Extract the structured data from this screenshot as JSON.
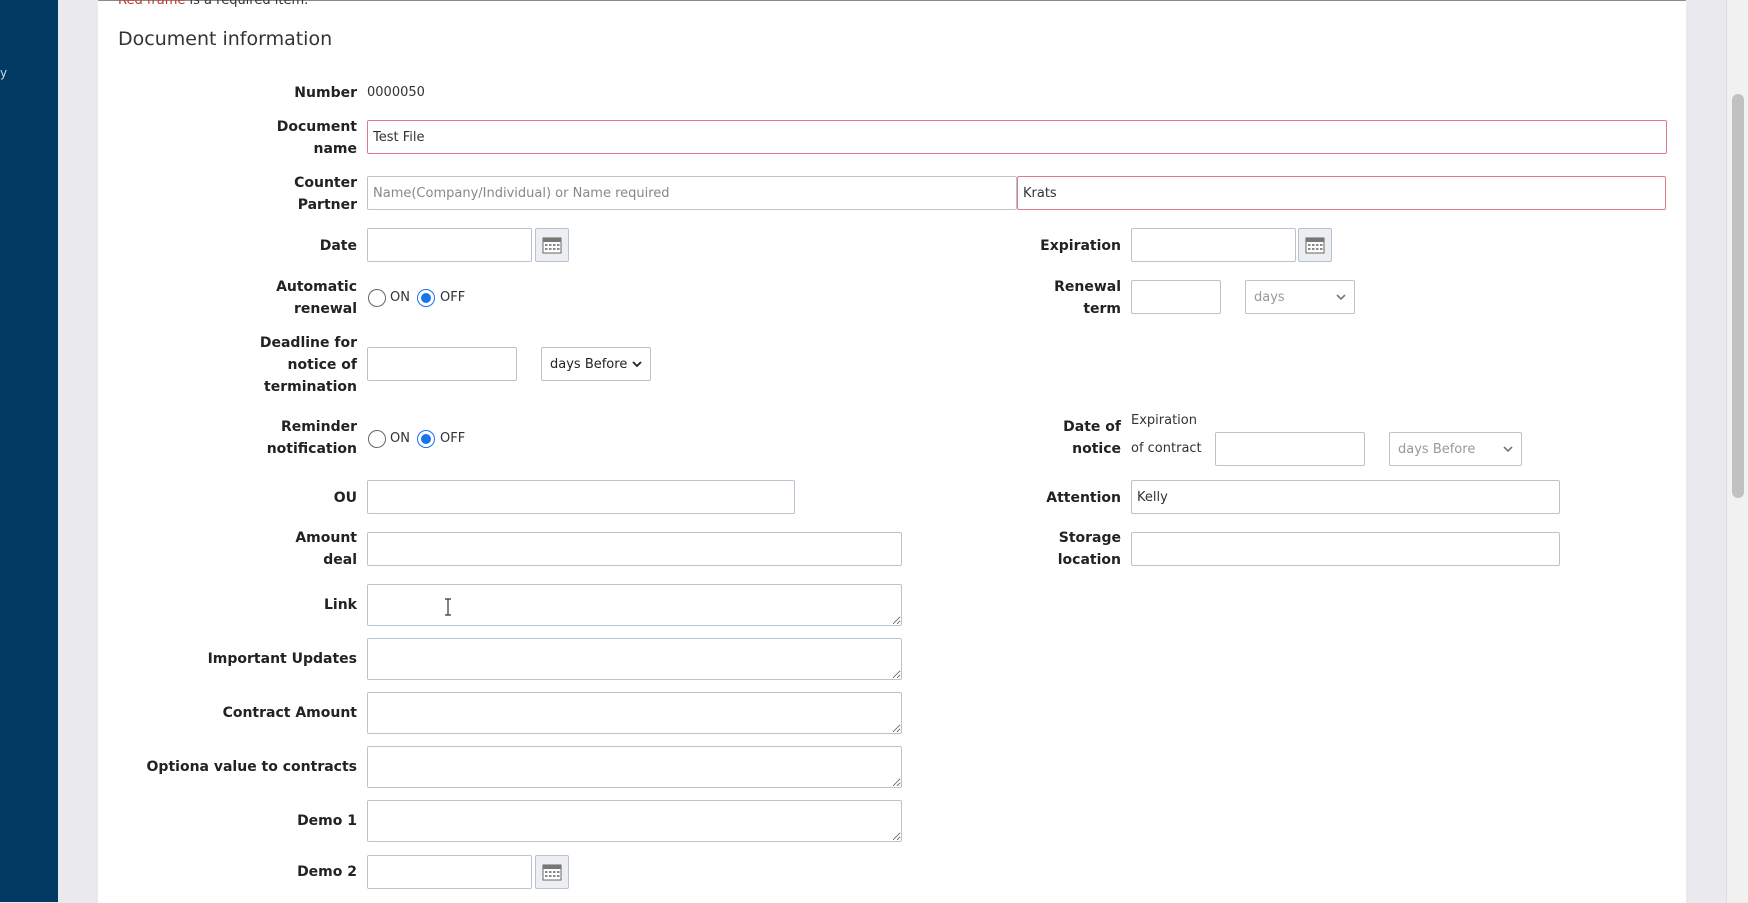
{
  "required_note": {
    "highlight": "Red frame",
    "rest": " is a required item."
  },
  "section_title": "Document information",
  "fields": {
    "number": {
      "label": "Number",
      "value": "0000050"
    },
    "document_name": {
      "label_l1": "Document",
      "label_l2": "name",
      "value": "Test File"
    },
    "counter_partner": {
      "label_l1": "Counter",
      "label_l2": "Partner",
      "placeholder": "Name(Company/Individual) or Name required",
      "value": "Krats"
    },
    "date": {
      "label": "Date"
    },
    "expiration": {
      "label": "Expiration"
    },
    "automatic_renewal": {
      "label_l1": "Automatic",
      "label_l2": "renewal",
      "on": "ON",
      "off": "OFF"
    },
    "renewal_term": {
      "label_l1": "Renewal",
      "label_l2": "term",
      "unit": "days"
    },
    "deadline": {
      "label_l1": "Deadline for",
      "label_l2": "notice of",
      "label_l3": "termination",
      "unit": "days Before"
    },
    "reminder": {
      "label_l1": "Reminder",
      "label_l2": "notification",
      "on": "ON",
      "off": "OFF"
    },
    "date_of_notice": {
      "label_l1": "Date of",
      "label_l2": "notice",
      "text_l1": "Expiration",
      "text_l2": "of contract",
      "unit": "days Before"
    },
    "ou": {
      "label": "OU"
    },
    "attention": {
      "label": "Attention",
      "value": "Kelly"
    },
    "amount_deal": {
      "label_l1": "Amount",
      "label_l2": "deal"
    },
    "storage_location": {
      "label_l1": "Storage",
      "label_l2": "location"
    },
    "link": {
      "label": "Link"
    },
    "important_updates": {
      "label": "Important Updates"
    },
    "contract_amount": {
      "label": "Contract Amount"
    },
    "optional_value": {
      "label": "Optiona value to contracts"
    },
    "demo1": {
      "label": "Demo 1"
    },
    "demo2": {
      "label": "Demo 2"
    }
  },
  "colors": {
    "sidebar": "#003a63",
    "required_border": "#e07a86",
    "radio_selected": "#1a73e8"
  }
}
